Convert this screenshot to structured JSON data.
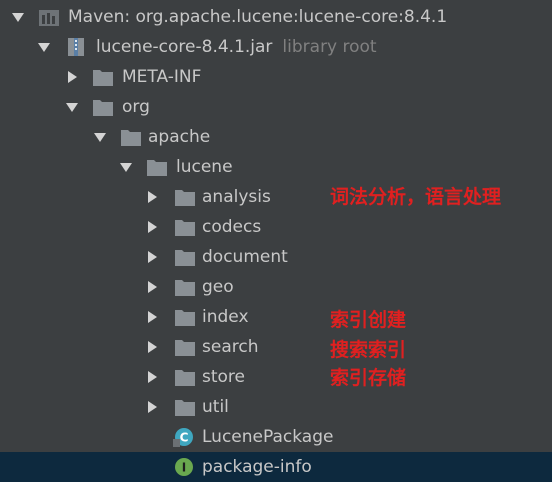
{
  "tree": {
    "maven_root": "Maven: org.apache.lucene:lucene-core:8.4.1",
    "jar": {
      "name": "lucene-core-8.4.1.jar",
      "hint": "library root"
    },
    "meta_inf": "META-INF",
    "org": "org",
    "apache": "apache",
    "lucene": "lucene",
    "packages": [
      "analysis",
      "codecs",
      "document",
      "geo",
      "index",
      "search",
      "store",
      "util"
    ],
    "lucene_package": "LucenePackage",
    "package_info": "package-info"
  },
  "annotations": {
    "analysis": "词法分析，语言处理",
    "index": "索引创建",
    "search": "搜索索引",
    "store": "索引存储"
  },
  "colors": {
    "background": "#3c3f41",
    "selected_row": "#0d293e",
    "text": "#c8c8c8",
    "hint": "#808080",
    "annotation": "#e02020",
    "folder": "#8a9095"
  }
}
